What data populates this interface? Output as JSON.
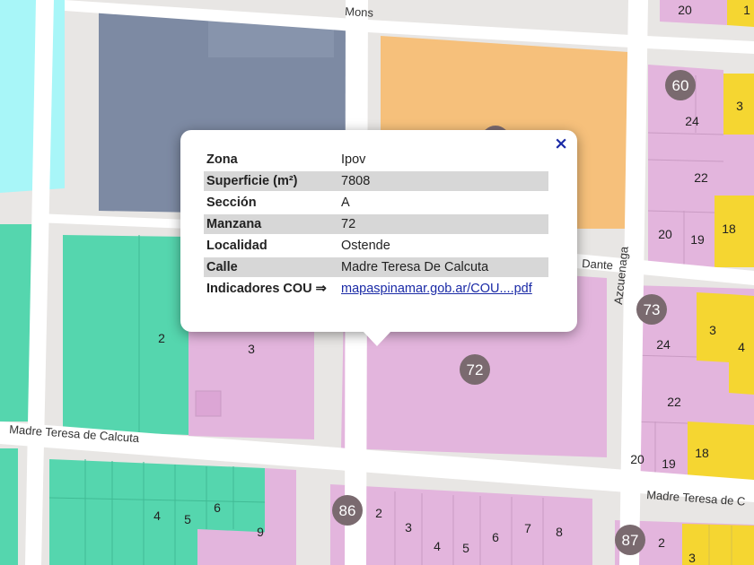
{
  "streets": {
    "mons": "Mons",
    "dante": "Dante",
    "azcuenaga": "Azcuenaga",
    "madre_left": "Madre Teresa de Calcuta",
    "madre_right": "Madre Teresa de C"
  },
  "block_badges": [
    "60",
    "73",
    "72",
    "86",
    "87"
  ],
  "lot_numbers": [
    "20",
    "24",
    "3",
    "22",
    "18",
    "20",
    "19",
    "3",
    "24",
    "4",
    "22",
    "18",
    "20",
    "19",
    "2",
    "3",
    "4",
    "5",
    "6",
    "9",
    "2",
    "3",
    "4",
    "5",
    "6",
    "7",
    "8",
    "2",
    "3",
    "1"
  ],
  "popup": {
    "close_label": "×",
    "rows": [
      {
        "label": "Zona",
        "value": "Ipov"
      },
      {
        "label": "Superficie (m²)",
        "value": "7808"
      },
      {
        "label": "Sección",
        "value": "A"
      },
      {
        "label": "Manzana",
        "value": "72"
      },
      {
        "label": "Localidad",
        "value": "Ostende"
      },
      {
        "label": "Calle",
        "value": "Madre Teresa De Calcuta"
      },
      {
        "label": "Indicadores COU ⇒",
        "value": "mapaspinamar.gob.ar/COU....pdf"
      }
    ]
  },
  "colors": {
    "pink": "#e3b5dd",
    "teal": "#55d6ae",
    "orange": "#f6c07b",
    "slate": "#7d8aa3",
    "cyan": "#a8f6f8",
    "yellow": "#f5d631",
    "badge": "#7a6a6f"
  }
}
